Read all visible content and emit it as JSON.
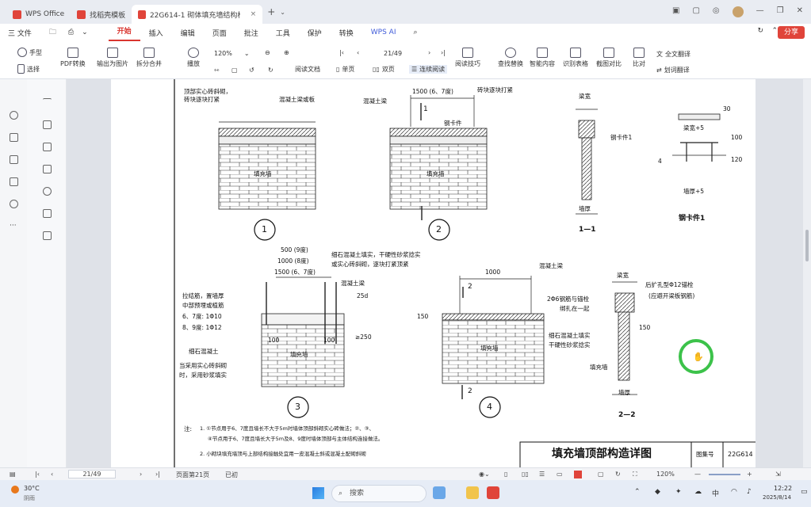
{
  "tabs": [
    {
      "label": "WPS Office",
      "logo_color": "#e0443a"
    },
    {
      "label": "找稻壳模板",
      "logo_color": "#e0443a"
    },
    {
      "label": "22G614-1 砌体填充墙结构构...",
      "logo_color": "#e0443a"
    }
  ],
  "menu": {
    "file": "三 文件",
    "items": [
      "开始",
      "插入",
      "编辑",
      "页面",
      "批注",
      "工具",
      "保护",
      "转换",
      "WPS AI"
    ],
    "active": "开始",
    "share": "分享"
  },
  "ribbon": {
    "hand": "手型",
    "select": "选择",
    "pdf_convert": "PDF转换",
    "export_image": "输出为图片",
    "split_merge": "拆分合并",
    "play": "播放",
    "zoom": "120%",
    "page": "21/49",
    "read_doc": "阅读文档",
    "single_page": "单页",
    "double_page": "双页",
    "continuous": "连续阅读",
    "read_tech": "阅读技巧",
    "find_replace": "查找替换",
    "extract_content": "智能内容",
    "recognize_table": "识别表格",
    "screenshot_compare": "截图对比",
    "compare": "比对",
    "full_translate": "全文翻译",
    "split_translate": "划词翻译"
  },
  "drawing": {
    "annotations": {
      "top_left_note_1": "顶部实心砖斜砌，",
      "top_left_note_2": "砖块逐块打紧",
      "concrete_beam_slab": "混凝土梁或板",
      "concrete_beam": "混凝土梁",
      "spacing_top": "1500 (6、7度)",
      "top_right_note": "砖块逐块打紧",
      "steel_clip": "钢卡件",
      "infill_wall": "填充墙",
      "beam_width": "梁宽",
      "steel_clip_1": "钢卡件1",
      "wall_thickness": "墙厚",
      "beam_width_plus5": "梁宽+5",
      "wall_thick_plus5": "墙厚+5",
      "section_11": "1—1",
      "section_22": "2—2",
      "clip_title": "钢卡件1",
      "spacing_500": "500 (9度)",
      "spacing_1000": "1000 (8度)",
      "spacing_1500": "1500 (6、7度)",
      "fine_stone_note_1": "细石混凝土填实，干硬性砂浆捻实",
      "fine_stone_note_2": "或实心砖斜砌，逐块打紧顶紧",
      "tie_bar_1": "拉结筋，置墙厚",
      "tie_bar_2": "中部预埋或植筋",
      "tie_bar_3": "6、7度: 1Φ10",
      "tie_bar_4": "8、9度: 1Φ12",
      "fine_stone_concrete": "细石混凝土",
      "solid_brick_note_1": "当采用实心砖斜砌",
      "solid_brick_note_2": "时，采用砂浆填实",
      "spacing_1000b": "1000",
      "two_bolts_1": "2Φ6钢筋与锚栓",
      "two_bolts_2": "绑扎在一起",
      "fine_stone_2a": "细石混凝土填实",
      "fine_stone_2b": "干硬性砂浆捻实",
      "post_anchor_1": "后扩孔型Φ12锚栓",
      "post_anchor_2": "(应避开梁板钢筋)",
      "dim_30": "30",
      "dim_100": "100",
      "dim_120": "120",
      "dim_4": "4",
      "dim_25d": "25d",
      "dim_250": "≥250",
      "dim_150": "150",
      "marker_2": "2",
      "marker_1": "1",
      "circle_1": "1",
      "circle_2": "2",
      "circle_3": "3",
      "circle_4": "4"
    },
    "notes": {
      "label": "注:",
      "line1": "1. ①节点用于6、7度且墙长不大于5m时墙体顶部斜砌实心砖做法；②、③、",
      "line1b": "④节点用于6、7度且墙长大于5m及8、9度时墙体顶部与主体结构连接做法。",
      "line2": "2. 小砌块填充墙顶与上部结构接触处宜用一皮混凝土斜或混凝土配砌斜砌"
    },
    "title_block": {
      "title": "填充墙顶部构造详图",
      "atlas_label": "图集号",
      "atlas_no": "22G614"
    }
  },
  "status": {
    "page_input": "21/49",
    "section": "页面第21页",
    "mode": "已初",
    "zoom": "120%"
  },
  "taskbar": {
    "temp": "30°C",
    "weather": "阴雨",
    "search": "搜索",
    "time": "12:22",
    "date": "2025/8/14"
  },
  "colors": {
    "accent": "#d9352f",
    "cursor_ring": "#3cc24a"
  }
}
